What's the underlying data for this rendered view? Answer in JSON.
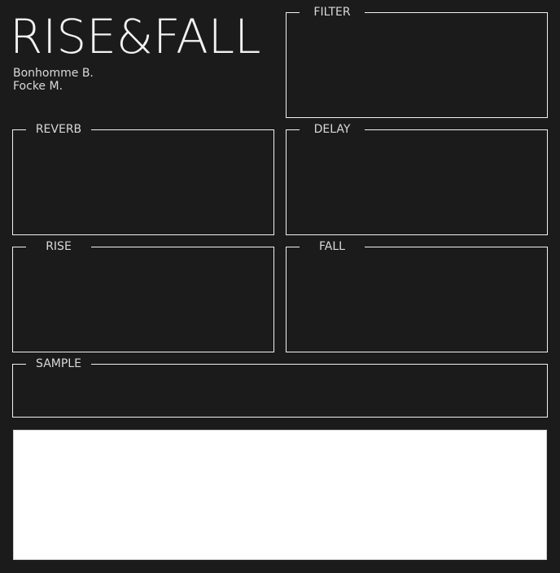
{
  "header": {
    "title": "RISE&FALL",
    "authors": [
      "Bonhomme B.",
      "Focke M."
    ]
  },
  "panels": {
    "filter": {
      "label": "FILTER"
    },
    "reverb": {
      "label": "REVERB"
    },
    "delay": {
      "label": "DELAY"
    },
    "rise": {
      "label": "RISE"
    },
    "fall": {
      "label": "FALL"
    },
    "sample": {
      "label": "SAMPLE"
    }
  },
  "colors": {
    "background": "#1b1b1b",
    "border": "#f2f2f2",
    "waveform_bg": "#ffffff"
  }
}
